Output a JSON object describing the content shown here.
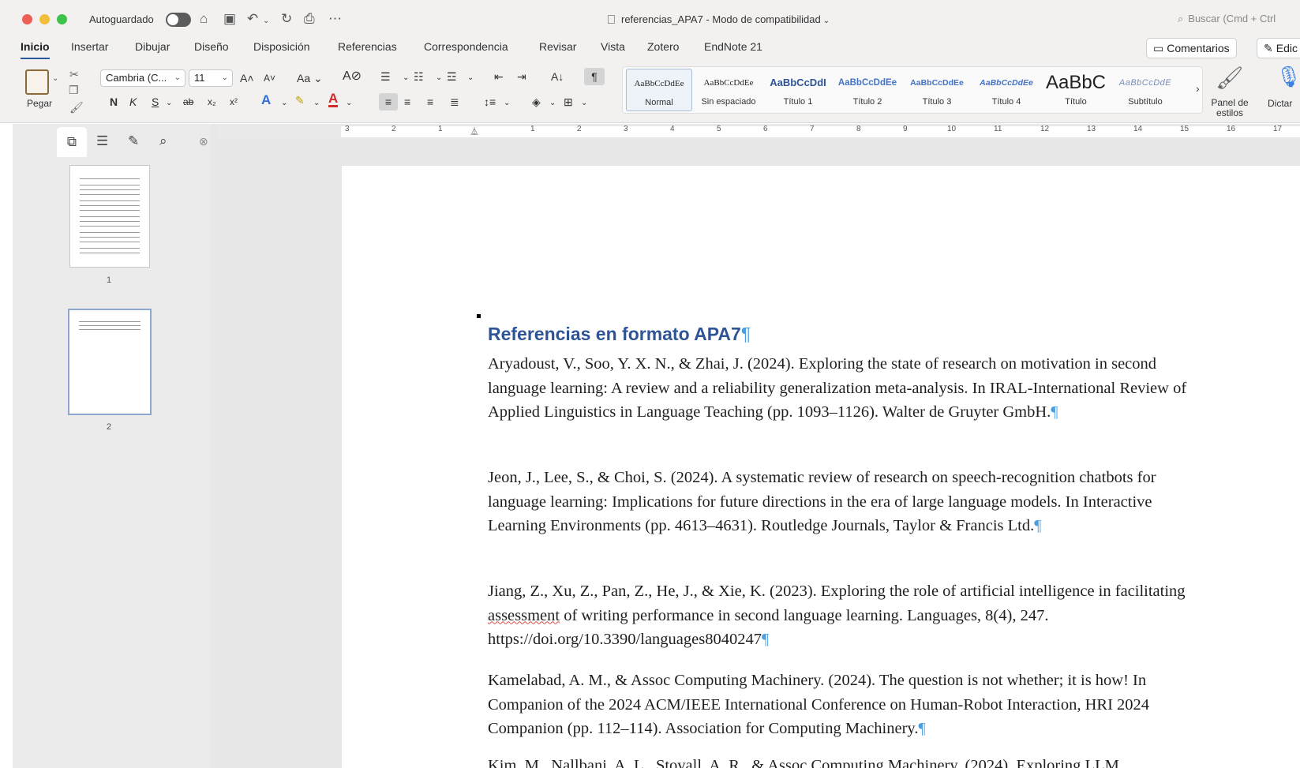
{
  "titlebar": {
    "autosave_label": "Autoguardado",
    "doc_title": "referencias_APA7  -  Modo de compatibilidad",
    "search_placeholder": "Buscar (Cmd + Ctrl"
  },
  "tabs": [
    {
      "label": "Inicio",
      "active": true
    },
    {
      "label": "Insertar"
    },
    {
      "label": "Dibujar"
    },
    {
      "label": "Diseño"
    },
    {
      "label": "Disposición"
    },
    {
      "label": "Referencias"
    },
    {
      "label": "Correspondencia"
    },
    {
      "label": "Revisar"
    },
    {
      "label": "Vista"
    },
    {
      "label": "Zotero"
    },
    {
      "label": "EndNote 21"
    }
  ],
  "actions": {
    "comments_label": "Comentarios",
    "edit_label": "Edic"
  },
  "ribbon": {
    "paste_label": "Pegar",
    "font_name": "Cambria (C...",
    "font_size": "11",
    "bold": "N",
    "italic": "K",
    "underline": "S",
    "styles": [
      {
        "preview": "AaBbCcDdEe",
        "name": "Normal",
        "selected": true,
        "color": "#222222"
      },
      {
        "preview": "AaBbCcDdEe",
        "name": "Sin espaciado",
        "color": "#222222"
      },
      {
        "preview": "AaBbCcDdI",
        "name": "Título 1",
        "color": "#2f5496"
      },
      {
        "preview": "AaBbCcDdEe",
        "name": "Título 2",
        "color": "#2f5496"
      },
      {
        "preview": "AaBbCcDdEe",
        "name": "Título 3",
        "color": "#1f3864"
      },
      {
        "preview": "AaBbCcDdEe",
        "name": "Título 4",
        "color": "#2f5496"
      },
      {
        "preview": "AaBbC",
        "name": "Título",
        "color": "#222222"
      },
      {
        "preview": "AaBbCcDdE",
        "name": "Subtítulo",
        "color": "#5a5a5a"
      }
    ],
    "panel_label": "Panel de estilos",
    "dictate_label": "Dictar"
  },
  "navpane": {
    "pages": [
      "1",
      "2"
    ]
  },
  "ruler": {
    "labels": [
      "3",
      "2",
      "1",
      "1",
      "2",
      "3",
      "4",
      "5",
      "6",
      "7",
      "8",
      "9",
      "10",
      "11",
      "12",
      "13",
      "14",
      "15",
      "16",
      "17"
    ]
  },
  "document": {
    "heading": "Referencias en formato APA7",
    "pilcrow": "¶",
    "references": [
      {
        "text": "Aryadoust, V., Soo, Y. X. N., & Zhai, J. (2024). Exploring the state of research on motivation in second language learning: A review and a reliability generalization meta-analysis. In IRAL-International Review of Applied Linguistics in Language Teaching (pp. 1093–1126). Walter de Gruyter GmbH."
      },
      {
        "text": "Jeon, J., Lee, S., & Choi, S. (2024). A systematic review of research on speech-recognition chatbots for language learning: Implications for future directions in the era of large language models. In Interactive Learning Environments (pp. 4613–4631). Routledge Journals, Taylor & Francis Ltd."
      },
      {
        "text_before": "Jiang, Z., Xu, Z., Pan, Z., He, J., & Xie, K. (2023). Exploring the role of artificial intelligence in facilitating ",
        "flagged_word": "assessment",
        "text_after": " of writing performance in second language learning. Languages, 8(4), 247. https://doi.org/10.3390/languages8040247"
      },
      {
        "text": "Kamelabad, A. M., & Assoc Computing Machinery. (2024). The question is not whether; it is how! In Companion of the 2024 ACM/IEEE International Conference on Human-Robot Interaction, HRI 2024 Companion (pp. 112–114). Association for Computing Machinery."
      },
      {
        "text": "Kim, M., Nallbani, A. L., Stovall, A. R., & Assoc Computing Machinery. (2024). Exploring LLM"
      }
    ]
  }
}
